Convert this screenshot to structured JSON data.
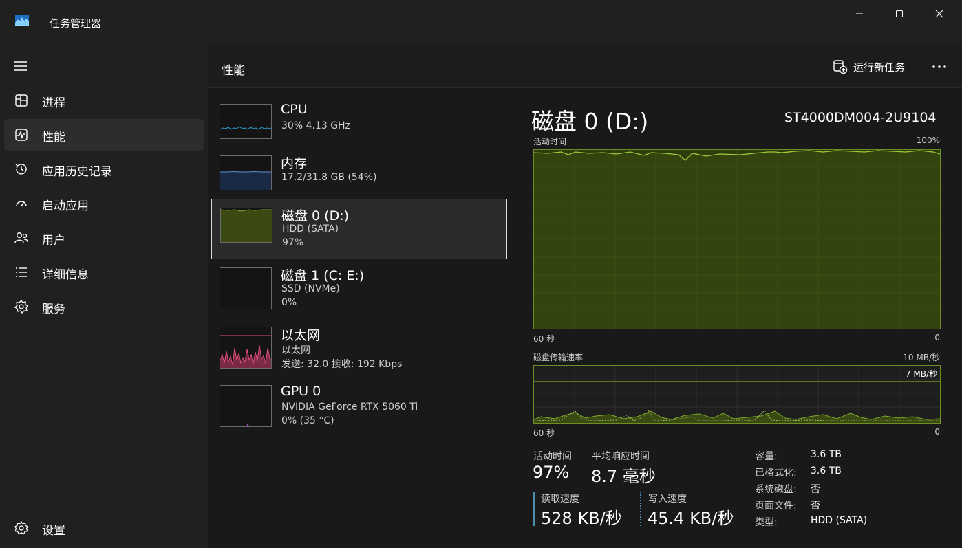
{
  "window": {
    "title": "任务管理器",
    "minimize_icon": "minimize-icon",
    "maximize_icon": "maximize-icon",
    "close_icon": "close-icon"
  },
  "sidebar": {
    "items": [
      {
        "label": "进程",
        "icon": "processes-icon"
      },
      {
        "label": "性能",
        "icon": "performance-icon",
        "active": true
      },
      {
        "label": "应用历史记录",
        "icon": "history-icon"
      },
      {
        "label": "启动应用",
        "icon": "startup-icon"
      },
      {
        "label": "用户",
        "icon": "users-icon"
      },
      {
        "label": "详细信息",
        "icon": "details-icon"
      },
      {
        "label": "服务",
        "icon": "services-icon"
      }
    ],
    "settings_label": "设置"
  },
  "header": {
    "title": "性能",
    "run_task_label": "运行新任务"
  },
  "devices": [
    {
      "name": "CPU",
      "sub1": "30%  4.13 GHz",
      "sub2": ""
    },
    {
      "name": "内存",
      "sub1": "17.2/31.8 GB (54%)",
      "sub2": ""
    },
    {
      "name": "磁盘 0 (D:)",
      "sub1": "HDD (SATA)",
      "sub2": "97%"
    },
    {
      "name": "磁盘 1 (C: E:)",
      "sub1": "SSD (NVMe)",
      "sub2": "0%"
    },
    {
      "name": "以太网",
      "sub1": "以太网",
      "sub2": "发送: 32.0  接收: 192 Kbps"
    },
    {
      "name": "GPU 0",
      "sub1": "NVIDIA GeForce RTX 5060 Ti",
      "sub2": "0% (35 °C)"
    }
  ],
  "detail": {
    "title": "磁盘 0 (D:)",
    "model": "ST4000DM004-2U9104",
    "activity_graph": {
      "label": "活动时间",
      "max_label": "100%",
      "time_label": "60 秒",
      "min_label": "0"
    },
    "transfer_graph": {
      "label": "磁盘传输速率",
      "max_label": "10 MB/秒",
      "line_label": "7 MB/秒",
      "time_label": "60 秒",
      "min_label": "0"
    },
    "stats": {
      "active_time_label": "活动时间",
      "active_time_value": "97%",
      "response_label": "平均响应时间",
      "response_value": "8.7 毫秒",
      "read_label": "读取速度",
      "read_value": "528 KB/秒",
      "write_label": "写入速度",
      "write_value": "45.4 KB/秒"
    },
    "properties": [
      {
        "key": "容量:",
        "value": "3.6 TB"
      },
      {
        "key": "已格式化:",
        "value": "3.6 TB"
      },
      {
        "key": "系统磁盘:",
        "value": "否"
      },
      {
        "key": "页面文件:",
        "value": "否"
      },
      {
        "key": "类型:",
        "value": "HDD (SATA)"
      }
    ]
  },
  "colors": {
    "disk_line": "#7dad2b",
    "disk_fill": "#3a4a12",
    "cpu_line": "#2fa4d6",
    "mem_line": "#5b8fd8",
    "net_line": "#e0507a",
    "gpu_line": "#b060d0"
  }
}
